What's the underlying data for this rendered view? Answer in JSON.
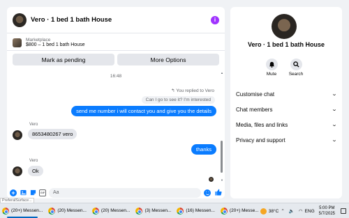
{
  "chat": {
    "title": "Vero · 1 bed 1 bath House",
    "info_icon": "i",
    "marketplace": {
      "label": "Marketplace",
      "listing": "$800 – 1 bed 1 bath House"
    },
    "buttons": {
      "pending": "Mark as pending",
      "more": "More Options"
    },
    "time": "16:48",
    "replied_note": "You replied to Vero",
    "quoted": "Can I go to see it? I'm interested",
    "messages": [
      {
        "from": "me",
        "text": "send me number i will contact you and give you the details"
      },
      {
        "from": "Vero",
        "sender": "Vero",
        "text": "8653480267 vero"
      },
      {
        "from": "me",
        "text": "thanks"
      },
      {
        "from": "Vero",
        "sender": "Vero",
        "text": "Ok"
      }
    ],
    "composer": {
      "placeholder": "Aa",
      "icons": [
        "plus-icon",
        "image-icon",
        "sticker-icon",
        "gif-icon",
        "emoji-icon",
        "thumbs-up-icon"
      ],
      "gif_label": "GIF"
    }
  },
  "info": {
    "title": "Vero · 1 bed 1 bath House",
    "quick_actions": [
      {
        "label": "Mute",
        "icon": "bell-icon"
      },
      {
        "label": "Search",
        "icon": "search-icon"
      }
    ],
    "menu": [
      "Customise chat",
      "Chat members",
      "Media, files and links",
      "Privacy and support"
    ]
  },
  "taskbar": {
    "tooltip": "PreferalSurface...",
    "tasks": [
      "(20+) Messen...",
      "(20) Messen...",
      "(20) Messen...",
      "(3) Messen...",
      "(16) Messen...",
      "(20+) Messe..."
    ],
    "weather": "38°C",
    "lang": "ENG",
    "time": "5:00 PM",
    "date": "5/7/2025"
  },
  "colors": {
    "accent": "#0a7cff",
    "info_button": "#a033ff",
    "background": "#f0f2f5"
  }
}
